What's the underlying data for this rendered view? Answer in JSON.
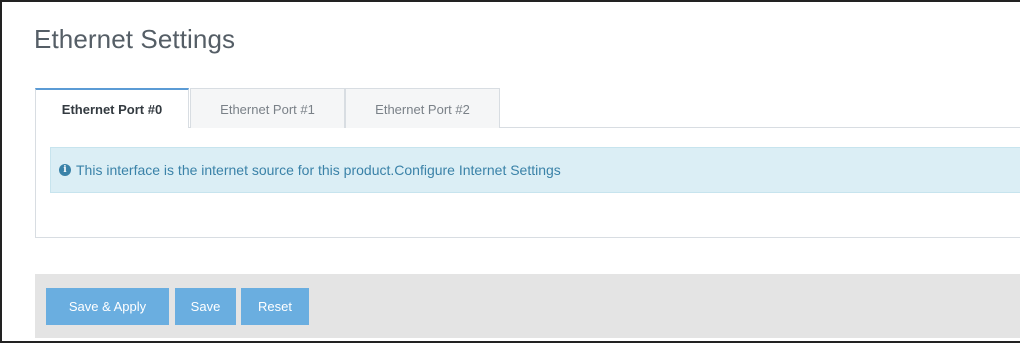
{
  "page": {
    "title": "Ethernet Settings"
  },
  "tabs": [
    {
      "label": "Ethernet Port #0",
      "active": true
    },
    {
      "label": "Ethernet Port #1",
      "active": false
    },
    {
      "label": "Ethernet Port #2",
      "active": false
    }
  ],
  "alert": {
    "icon": "info-icon",
    "icon_glyph": "i",
    "message": "This interface is the internet source for this product.",
    "link_text": "Configure Internet Settings"
  },
  "actions": {
    "save_apply_label": "Save & Apply",
    "save_label": "Save",
    "reset_label": "Reset"
  },
  "colors": {
    "accent": "#6aaee0",
    "alert_bg": "#dbeef5",
    "alert_text": "#3a82a8",
    "footer_bg": "#e4e4e4"
  }
}
